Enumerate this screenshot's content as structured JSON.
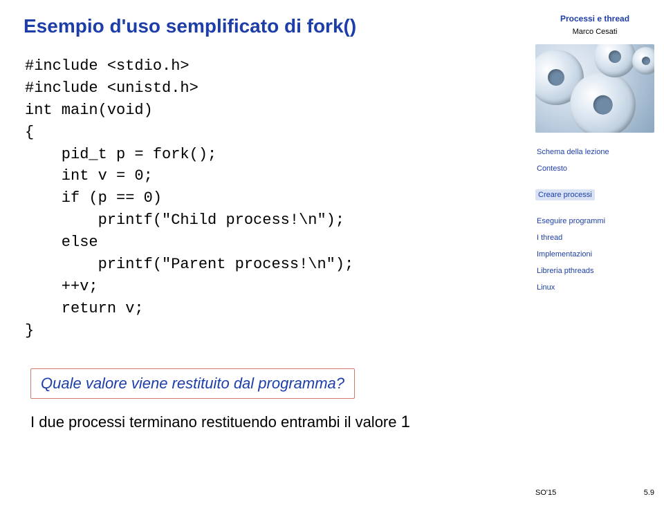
{
  "title": "Esempio d'uso semplificato di fork()",
  "code": "#include <stdio.h>\n#include <unistd.h>\nint main(void)\n{\n    pid_t p = fork();\n    int v = 0;\n    if (p == 0)\n        printf(\"Child process!\\n\");\n    else\n        printf(\"Parent process!\\n\");\n    ++v;\n    return v;\n}",
  "callout": "Quale valore viene restituito dal programma?",
  "conclusion_pre": "I due processi terminano restituendo entrambi il valore ",
  "conclusion_value": "1",
  "sidebar": {
    "header": "Processi e thread",
    "author": "Marco Cesati",
    "nav": {
      "n0": "Schema della lezione",
      "n1": "Contesto",
      "n2": "Creare processi",
      "n3": "Eseguire programmi",
      "n4": "I thread",
      "n5": "Implementazioni",
      "n6": "Libreria pthreads",
      "n7": "Linux"
    }
  },
  "footer": {
    "left": "SO'15",
    "right": "5.9"
  }
}
